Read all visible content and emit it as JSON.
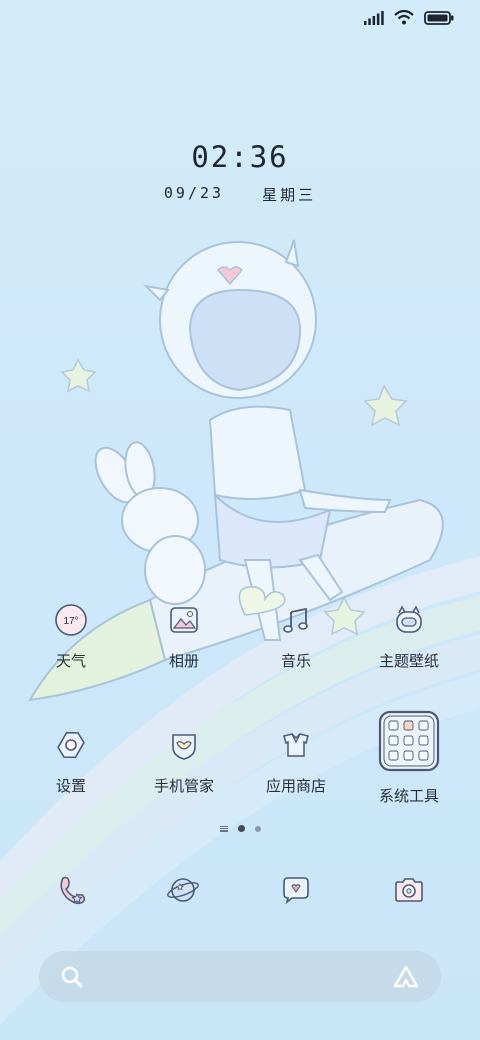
{
  "lock": {
    "time": "02:36",
    "date": "09/23",
    "weekday": "星期三"
  },
  "status_bar": {
    "icons": [
      "signal-icon",
      "wifi-icon",
      "battery-icon"
    ]
  },
  "apps": [
    {
      "label": "天气",
      "icon": "weather-icon",
      "badge": "17°"
    },
    {
      "label": "相册",
      "icon": "gallery-icon"
    },
    {
      "label": "音乐",
      "icon": "music-icon"
    },
    {
      "label": "主题壁纸",
      "icon": "themes-icon"
    },
    {
      "label": "设置",
      "icon": "settings-icon"
    },
    {
      "label": "手机管家",
      "icon": "security-icon"
    },
    {
      "label": "应用商店",
      "icon": "app-store-icon"
    },
    {
      "label": "系统工具",
      "icon": "tools-folder-icon"
    }
  ],
  "page_indicator": {
    "pages": 2,
    "current": 1
  },
  "dock": [
    {
      "icon": "phone-icon"
    },
    {
      "icon": "browser-icon"
    },
    {
      "icon": "messages-icon"
    },
    {
      "icon": "camera-icon"
    }
  ],
  "search": {
    "icon": "search-icon",
    "assistant_icon": "assistant-icon"
  },
  "colors": {
    "background": "#cde8fa",
    "icon_stroke": "#4a5a78",
    "text": "#2a2f3a"
  }
}
